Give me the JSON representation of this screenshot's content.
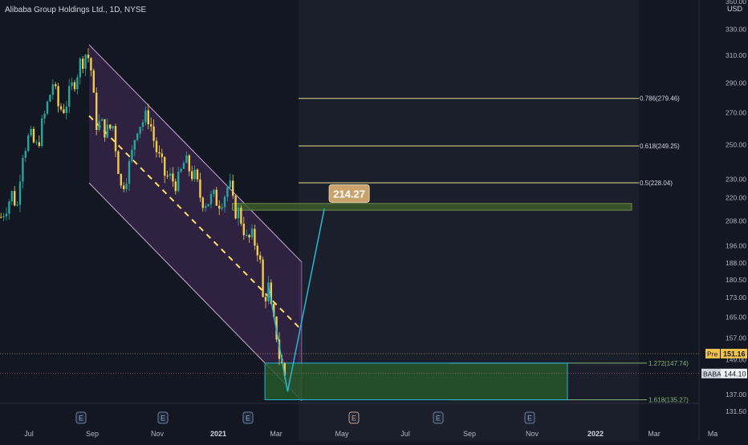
{
  "header": {
    "symbol_title": "Alibaba Group Holdings Ltd., 1D, NYSE"
  },
  "currency": "USD",
  "chart_data": {
    "type": "candlestick",
    "title": "Alibaba Group Holdings Ltd., 1D, NYSE",
    "y_scale": "log",
    "ylim": [
      128,
      320
    ],
    "y_ticks": [
      131.5,
      137.0,
      149.0,
      157.0,
      165.0,
      173.0,
      180.5,
      188.0,
      196.0,
      208.0,
      220.0,
      230.0,
      250.0,
      270.0,
      290.0,
      310.0,
      330.0
    ],
    "y_tick_labels": [
      "131.50",
      "137.00",
      "149.00",
      "157.00",
      "165.00",
      "173.00",
      "180.50",
      "188.00",
      "196.00",
      "208.00",
      "220.00",
      "230.00",
      "250.00",
      "270.00",
      "290.00",
      "310.00",
      "330.00"
    ],
    "top_partial_label": "350.00",
    "x_ticks": [
      "Jul",
      "Sep",
      "Nov",
      "2021",
      "Mar",
      "May",
      "Jul",
      "Sep",
      "Nov",
      "2022",
      "Mar",
      "Ma"
    ],
    "bold_x_ticks": [
      "2021",
      "2022"
    ],
    "earnings_markers": [
      "E",
      "E",
      "E",
      "E",
      "E",
      "E"
    ],
    "price_path": [
      [
        "2020-06-01",
        210
      ],
      [
        "2020-06-10",
        216
      ],
      [
        "2020-06-20",
        222
      ],
      [
        "2020-06-30",
        215
      ],
      [
        "2020-07-06",
        245
      ],
      [
        "2020-07-20",
        255
      ],
      [
        "2020-08-01",
        248
      ],
      [
        "2020-08-15",
        268
      ],
      [
        "2020-08-24",
        282
      ],
      [
        "2020-08-30",
        292
      ],
      [
        "2020-09-05",
        275
      ],
      [
        "2020-09-15",
        272
      ],
      [
        "2020-09-25",
        280
      ],
      [
        "2020-10-05",
        292
      ],
      [
        "2020-10-15",
        304
      ],
      [
        "2020-10-25",
        312
      ],
      [
        "2020-11-01",
        306
      ],
      [
        "2020-11-05",
        290
      ],
      [
        "2020-11-10",
        264
      ],
      [
        "2020-11-20",
        262
      ],
      [
        "2020-12-01",
        258
      ],
      [
        "2020-12-10",
        262
      ],
      [
        "2020-12-20",
        236
      ],
      [
        "2020-12-24",
        225
      ],
      [
        "2020-12-30",
        230
      ],
      [
        "2021-01-10",
        240
      ],
      [
        "2021-01-20",
        262
      ],
      [
        "2021-02-01",
        265
      ],
      [
        "2021-02-10",
        268
      ],
      [
        "2021-02-20",
        250
      ],
      [
        "2021-03-01",
        240
      ],
      [
        "2021-03-10",
        232
      ],
      [
        "2021-03-20",
        230
      ],
      [
        "2021-04-01",
        228
      ],
      [
        "2021-04-12",
        240
      ],
      [
        "2021-04-20",
        236
      ],
      [
        "2021-05-01",
        230
      ],
      [
        "2021-05-10",
        220
      ],
      [
        "2021-05-20",
        218
      ],
      [
        "2021-06-01",
        220
      ],
      [
        "2021-06-10",
        218
      ],
      [
        "2021-06-20",
        222
      ],
      [
        "2021-06-28",
        228
      ],
      [
        "2021-07-05",
        215
      ],
      [
        "2021-07-15",
        212
      ],
      [
        "2021-07-22",
        206
      ],
      [
        "2021-07-28",
        198
      ],
      [
        "2021-08-05",
        200
      ],
      [
        "2021-08-15",
        196
      ],
      [
        "2021-08-20",
        188
      ],
      [
        "2021-08-25",
        172
      ],
      [
        "2021-09-01",
        176
      ],
      [
        "2021-09-05",
        178
      ],
      [
        "2021-09-10",
        160
      ],
      [
        "2021-09-15",
        164
      ],
      [
        "2021-09-20",
        152
      ],
      [
        "2021-09-25",
        148
      ],
      [
        "2021-10-01",
        144
      ],
      [
        "2021-10-05",
        140
      ]
    ],
    "channel": {
      "upper": [
        [
          "2020-11-01",
          318
        ],
        [
          "2021-11-01",
          188.5
        ]
      ],
      "median": [
        [
          "2020-11-01",
          268
        ],
        [
          "2021-11-01",
          160
        ]
      ],
      "lower": [
        [
          "2020-11-01",
          228
        ],
        [
          "2021-11-01",
          135
        ]
      ]
    },
    "fib_levels": [
      {
        "label": "0.786(279.46)",
        "value": 279.46
      },
      {
        "label": "0.618(249.25)",
        "value": 249.25
      },
      {
        "label": "0.5(228.04)",
        "value": 228.04
      },
      {
        "label": "1.272(147.74)",
        "value": 147.74
      },
      {
        "label": "1.618(135.27)",
        "value": 135.27
      }
    ],
    "zones": [
      {
        "name": "resistance",
        "from": "2021-07-05",
        "to": "2021-12-25",
        "low": 213.5,
        "high": 217.0,
        "color": "#3c5b2a"
      },
      {
        "name": "support",
        "from": "2021-08-30",
        "to": "2021-10-30",
        "low": 135.27,
        "high": 147.74,
        "color": "#255728"
      }
    ],
    "projection": [
      [
        "2021-09-05",
        178
      ],
      [
        "2021-10-08",
        138
      ],
      [
        "2021-12-10",
        214.27
      ]
    ],
    "target_label": "214.27",
    "current_price": {
      "symbol": "BABA",
      "value": "144.10"
    },
    "premarket": {
      "label": "Pre",
      "value": "151.16"
    },
    "colors": {
      "up": "#26a69a",
      "down": "#f0ca4c",
      "channel_fill": "#7b3f8f",
      "median": "#ffe066",
      "projection": "#29b6d6",
      "target_badge": "#c9a36b"
    }
  }
}
